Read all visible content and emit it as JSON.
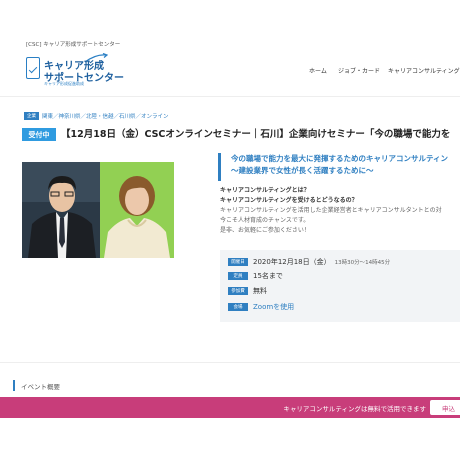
{
  "topbar": {
    "site_label": "[CSC] キャリア形成サポートセンター"
  },
  "logo": {
    "line1": "キャリア形成",
    "line2": "サポートセンター",
    "sub": "キャリア形成促進助成"
  },
  "nav": {
    "items": [
      {
        "label": "ホーム"
      },
      {
        "label": "ジョブ・カード"
      },
      {
        "label": "キャリアコンサルティング"
      }
    ]
  },
  "event": {
    "category_badge": "企業",
    "tags": "関東／神奈川県／北陸・信越／石川県／オンライン",
    "status": "受付中",
    "title": "【12月18日（金）CSCオンラインセミナー｜石川】企業向けセミナー「今の職場で能力を",
    "subtitle1": "今の職場で能力を最大に発揮するためのキャリアコンサルティン",
    "subtitle2": "～建設業界で女性が長く活躍するために～",
    "desc": {
      "q1": "キャリアコンサルティングとは？",
      "q2": "キャリアコンサルティングを受けるとどうなるの？",
      "p1": "キャリアコンサルティングを活用した企業経営者とキャリアコンサルタントとの対",
      "p2": "今こそ人材育成のチャンスです。",
      "p3": "是非、お気軽にご参加ください！"
    },
    "info": {
      "date_label": "開催日",
      "date_value": "2020年12月18日（金）",
      "date_time": "13時30分～14時45分",
      "capacity_label": "定員",
      "capacity_value": "15名まで",
      "fee_label": "参加費",
      "fee_value": "無料",
      "venue_label": "会場",
      "venue_value": "Zoomを使用"
    }
  },
  "section": {
    "overview": "イベント概要"
  },
  "cta": {
    "text": "キャリアコンサルティングは無料で活用できます",
    "button": "申込"
  },
  "colors": {
    "accent": "#2f7fc1",
    "cta": "#c83d7a",
    "status": "#2f9be0"
  }
}
